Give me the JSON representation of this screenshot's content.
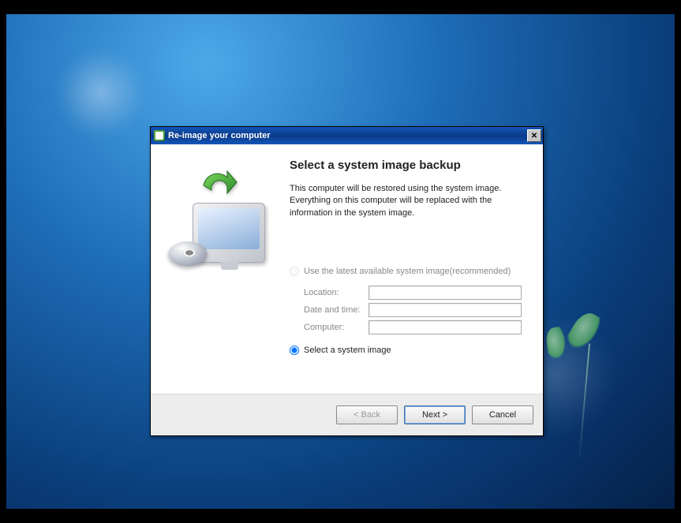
{
  "window": {
    "title": "Re-image your computer"
  },
  "heading": "Select a system image backup",
  "description": "This computer will be restored using the system image. Everything on this computer will be replaced with the information in the system image.",
  "options": {
    "latest": {
      "label": "Use the latest available system image(recommended)",
      "enabled": false
    },
    "select": {
      "label": "Select a system image",
      "checked": true
    }
  },
  "fields": {
    "location": {
      "label": "Location:",
      "value": ""
    },
    "datetime": {
      "label": "Date and time:",
      "value": ""
    },
    "computer": {
      "label": "Computer:",
      "value": ""
    }
  },
  "buttons": {
    "back": "< Back",
    "next": "Next >",
    "cancel": "Cancel"
  }
}
